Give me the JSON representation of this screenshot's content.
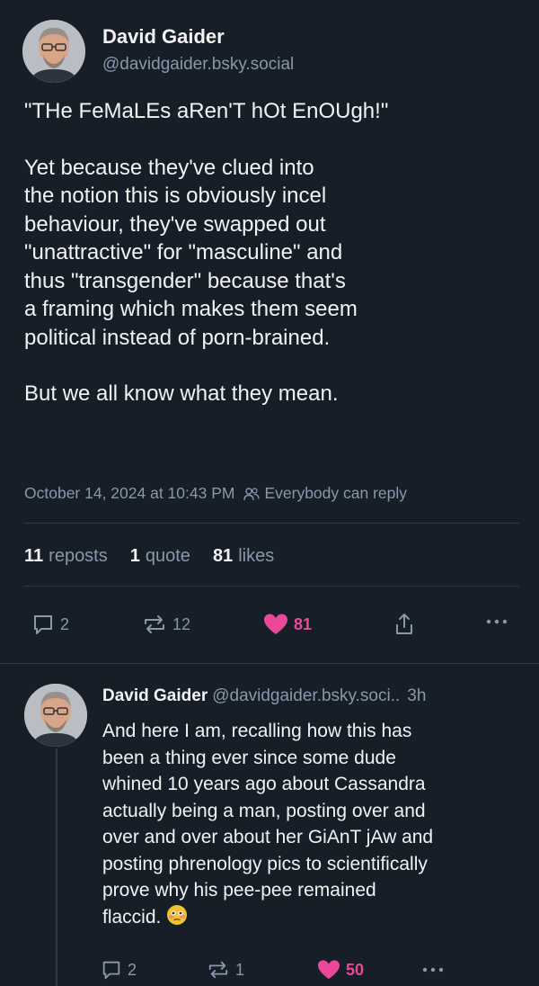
{
  "post": {
    "author_name": "David Gaider",
    "author_handle": "@davidgaider.bsky.social",
    "paragraphs": [
      "\"THe FeMaLEs aRen'T hOt EnOUgh!\"",
      "Yet because they've clued into\nthe notion this is obviously incel\nbehaviour, they've swapped out\n\"unattractive\" for \"masculine\" and\nthus \"transgender\" because that's\na framing which makes them seem\npolitical instead of porn-brained.",
      "But we all know what they mean."
    ],
    "timestamp": "October 14, 2024 at 10:43 PM",
    "reply_setting": "Everybody can reply",
    "stats": {
      "reposts_count": "11",
      "reposts_label": "reposts",
      "quotes_count": "1",
      "quotes_label": "quote",
      "likes_count": "81",
      "likes_label": "likes"
    },
    "actions": {
      "replies": "2",
      "reposts": "12",
      "likes": "81"
    }
  },
  "reply": {
    "author_name": "David Gaider",
    "author_handle": "@davidgaider.bsky.soci..",
    "time_ago": "3h",
    "text": "And here I am, recalling how this has\nbeen a thing ever since some dude\nwhined 10 years ago about Cassandra\nactually being a man, posting over and\nover and over about her GiAnT jAw and\nposting phrenology pics to scientifically\nprove why his pee-pee remained\nflaccid.",
    "emoji": "flushed-face",
    "actions": {
      "replies": "2",
      "reposts": "1",
      "likes": "50"
    }
  },
  "colors": {
    "background": "#161e27",
    "text_primary": "#f1f3f5",
    "text_secondary": "#8a98a8",
    "like_active": "#ec4899",
    "divider": "#2c3947"
  }
}
